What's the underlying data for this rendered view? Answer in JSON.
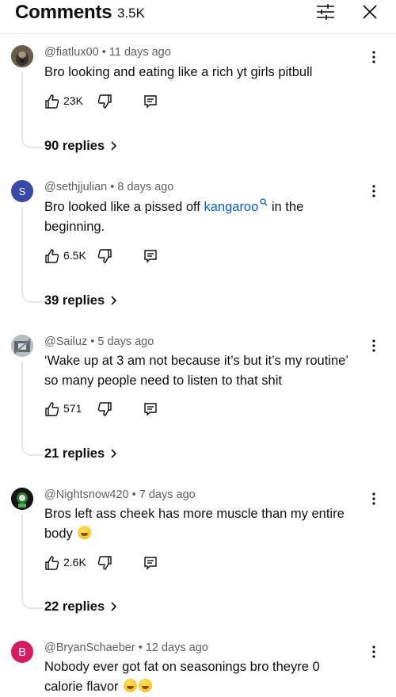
{
  "header": {
    "title": "Comments",
    "count": "3.5K",
    "filter_icon": "sliders-icon",
    "close_icon": "close-icon"
  },
  "comments": [
    {
      "author": "@fiatlux00",
      "age": "11 days ago",
      "text": "Bro looking and eating like a rich yt girls pitbull",
      "likes": "23K",
      "replies": "90 replies",
      "avatar": "photo-dog"
    },
    {
      "author": "@sethjjulian",
      "age": "8 days ago",
      "text_before": "Bro looked like a pissed off ",
      "link_text": "kangaroo",
      "text_after": " in the beginning.",
      "likes": "6.5K",
      "replies": "39 replies",
      "avatar_letter": "S",
      "avatar_color": "#3949ab"
    },
    {
      "author": "@Sailuz",
      "age": "5 days ago",
      "text": "‘Wake up at 3 am not because it’s but it’s my routine’ so many people need to listen to that shit",
      "likes": "571",
      "replies": "21 replies",
      "avatar": "photo-person"
    },
    {
      "author": "@Nightsnow420",
      "age": "7 days ago",
      "text": "Bros left ass cheek has more muscle than my entire body",
      "emoji": "rolling-on-floor-laughing",
      "likes": "2.6K",
      "replies": "22 replies",
      "avatar": "photo-dark"
    },
    {
      "author": "@BryanSchaeber",
      "age": "12 days ago",
      "text": "Nobody ever got fat on seasonings bro theyre 0 calorie flavor",
      "emoji": "face-with-tears-of-joy",
      "avatar_letter": "B",
      "avatar_color": "#d81b60"
    }
  ]
}
